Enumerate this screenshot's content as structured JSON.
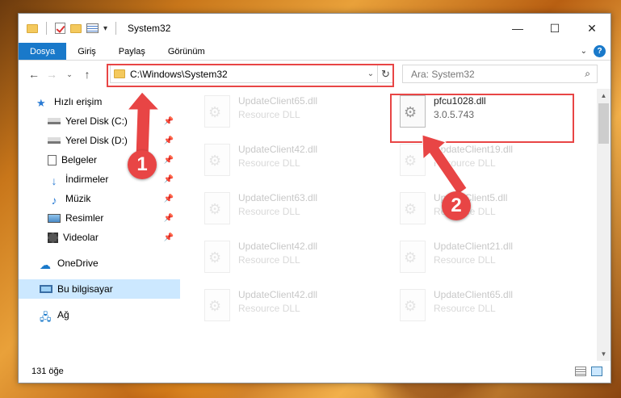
{
  "window": {
    "title": "System32"
  },
  "ribbon": {
    "tabs": [
      "Dosya",
      "Giriş",
      "Paylaş",
      "Görünüm"
    ],
    "help": "?"
  },
  "address": {
    "path": "C:\\Windows\\System32"
  },
  "search": {
    "placeholder": "Ara: System32"
  },
  "sidebar": {
    "items": [
      {
        "label": "Hızlı erişim",
        "pinned": false,
        "icon": "star-icon"
      },
      {
        "label": "Yerel Disk (C:)",
        "pinned": true,
        "icon": "drive-icon"
      },
      {
        "label": "Yerel Disk (D:)",
        "pinned": true,
        "icon": "drive-icon"
      },
      {
        "label": "Belgeler",
        "pinned": true,
        "icon": "documents-icon"
      },
      {
        "label": "İndirmeler",
        "pinned": true,
        "icon": "download-icon"
      },
      {
        "label": "Müzik",
        "pinned": true,
        "icon": "music-icon"
      },
      {
        "label": "Resimler",
        "pinned": true,
        "icon": "pictures-icon"
      },
      {
        "label": "Videolar",
        "pinned": true,
        "icon": "videos-icon"
      },
      {
        "label": "OneDrive",
        "pinned": false,
        "icon": "cloud-icon"
      },
      {
        "label": "Bu bilgisayar",
        "pinned": false,
        "icon": "computer-icon"
      },
      {
        "label": "Ağ",
        "pinned": false,
        "icon": "network-icon"
      }
    ]
  },
  "files": [
    {
      "name": "UpdateClient65.dll",
      "sub": "Resource DLL"
    },
    {
      "name": "pfcu1028.dll",
      "sub": "3.0.5.743"
    },
    {
      "name": "UpdateClient42.dll",
      "sub": "Resource DLL"
    },
    {
      "name": "UpdateClient19.dll",
      "sub": "Resource DLL"
    },
    {
      "name": "UpdateClient63.dll",
      "sub": "Resource DLL"
    },
    {
      "name": "UpdateClient5.dll",
      "sub": "Resource DLL"
    },
    {
      "name": "UpdateClient42.dll",
      "sub": "Resource DLL"
    },
    {
      "name": "UpdateClient21.dll",
      "sub": "Resource DLL"
    },
    {
      "name": "UpdateClient42.dll",
      "sub": "Resource DLL"
    },
    {
      "name": "UpdateClient65.dll",
      "sub": "Resource DLL"
    }
  ],
  "status": {
    "count": "131 öğe"
  },
  "callouts": [
    "1",
    "2"
  ],
  "colors": {
    "accent": "#1979ca",
    "highlight": "#e84545",
    "selected": "#cce8ff"
  }
}
